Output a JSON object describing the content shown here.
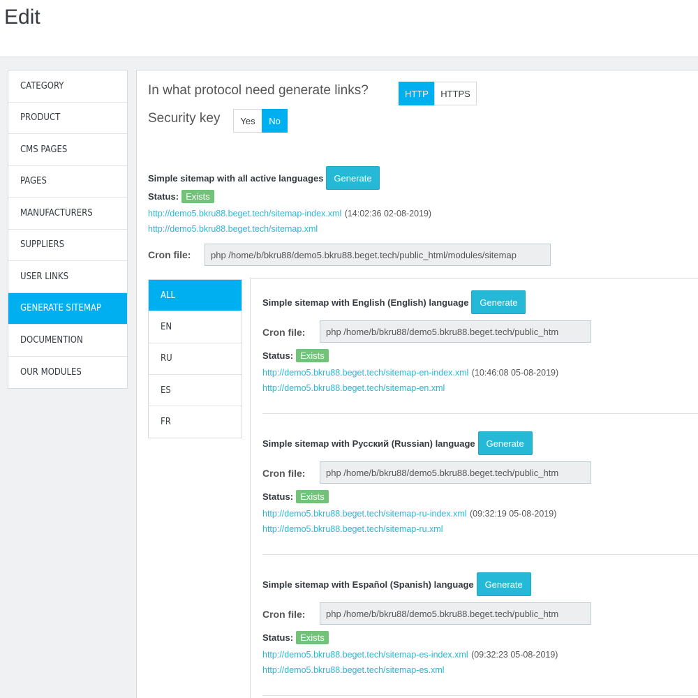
{
  "page_title": "Edit",
  "sidebar": {
    "items": [
      {
        "label": "CATEGORY"
      },
      {
        "label": "PRODUCT"
      },
      {
        "label": "CMS PAGES"
      },
      {
        "label": "PAGES"
      },
      {
        "label": "MANUFACTURERS"
      },
      {
        "label": "SUPPLIERS"
      },
      {
        "label": "USER LINKS"
      },
      {
        "label": "GENERATE SITEMAP"
      },
      {
        "label": "DOCUMENTION"
      },
      {
        "label": "OUR MODULES"
      }
    ],
    "active_index": 7
  },
  "protocol": {
    "question": "In what protocol need generate links?",
    "options": [
      "HTTP",
      "HTTPS"
    ],
    "selected": "HTTP"
  },
  "security_key": {
    "label": "Security key",
    "options": [
      "Yes",
      "No"
    ],
    "selected": "No"
  },
  "all_languages": {
    "title": "Simple sitemap with all active languages",
    "generate_label": "Generate",
    "status_label": "Status:",
    "status_value": "Exists",
    "link_index": "http://demo5.bkru88.beget.tech/sitemap-index.xml",
    "link_index_time": "(14:02:36 02-08-2019)",
    "link_main": "http://demo5.bkru88.beget.tech/sitemap.xml",
    "cron_label": "Cron file:",
    "cron_value": "php /home/b/bkru88/demo5.bkru88.beget.tech/public_html/modules/sitemap"
  },
  "lang_tabs": [
    "ALL",
    "EN",
    "RU",
    "ES",
    "FR"
  ],
  "languages": [
    {
      "title": "Simple sitemap with English (English) language",
      "generate_label": "Generate",
      "cron_label": "Cron file:",
      "cron_value": "php /home/b/bkru88/demo5.bkru88.beget.tech/public_htm",
      "status_label": "Status:",
      "status_value": "Exists",
      "link_index": "http://demo5.bkru88.beget.tech/sitemap-en-index.xml",
      "link_index_time": "(10:46:08 05-08-2019)",
      "link_main": "http://demo5.bkru88.beget.tech/sitemap-en.xml"
    },
    {
      "title": "Simple sitemap with Русский (Russian) language",
      "generate_label": "Generate",
      "cron_label": "Cron file:",
      "cron_value": "php /home/b/bkru88/demo5.bkru88.beget.tech/public_htm",
      "status_label": "Status:",
      "status_value": "Exists",
      "link_index": "http://demo5.bkru88.beget.tech/sitemap-ru-index.xml",
      "link_index_time": "(09:32:19 05-08-2019)",
      "link_main": "http://demo5.bkru88.beget.tech/sitemap-ru.xml"
    },
    {
      "title": "Simple sitemap with Español (Spanish) language",
      "generate_label": "Generate",
      "cron_label": "Cron file:",
      "cron_value": "php /home/b/bkru88/demo5.bkru88.beget.tech/public_htm",
      "status_label": "Status:",
      "status_value": "Exists",
      "link_index": "http://demo5.bkru88.beget.tech/sitemap-es-index.xml",
      "link_index_time": "(09:32:23 05-08-2019)",
      "link_main": "http://demo5.bkru88.beget.tech/sitemap-es.xml"
    }
  ],
  "colors": {
    "accent": "#00aff0",
    "generate_button": "#25b9d7",
    "status_success": "#72c279",
    "link": "#25b9d7"
  }
}
